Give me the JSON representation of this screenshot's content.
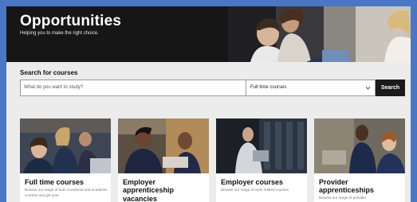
{
  "hero": {
    "title": "Opportunities",
    "subtitle": "Helping you to make the right choice."
  },
  "search": {
    "label": "Search for courses",
    "placeholder": "What do you want to study?",
    "selected_type": "Full time courses",
    "button_label": "Search"
  },
  "cards": [
    {
      "title": "Full time courses",
      "description": "Browse our range of both vocational and academic courses and get your"
    },
    {
      "title": "Employer apprenticeship vacancies",
      "description": ""
    },
    {
      "title": "Employer courses",
      "description": "Browse our range of work related courses"
    },
    {
      "title": "Provider apprenticeships",
      "description": "Browse our range of provider"
    }
  ],
  "colors": {
    "page_border": "#4a76c4",
    "hero_bg": "#161616",
    "search_bg": "#ececec",
    "button": "#1a1a1a"
  }
}
